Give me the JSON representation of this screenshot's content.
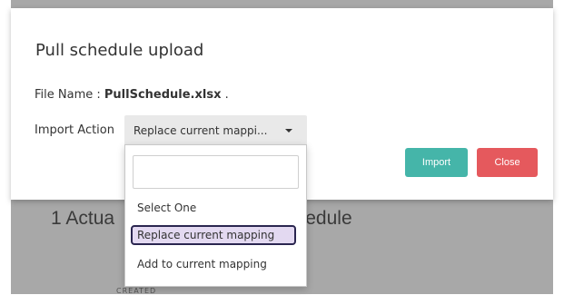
{
  "background": {
    "heading_left": "1 Actua",
    "heading_right": "chedule",
    "subtext": "CREATED"
  },
  "dialog": {
    "title": "Pull schedule upload",
    "file_label": "File Name : ",
    "file_name": "PullSchedule.xlsx",
    "file_suffix": " .",
    "import_action_label": "Import Action",
    "select_value": "Replace current mappi...",
    "import_button": "Import",
    "close_button": "Close"
  },
  "dropdown": {
    "search_value": "",
    "options": [
      {
        "label": "Select One"
      },
      {
        "label": "Replace current mapping"
      },
      {
        "label": "Add to current mapping"
      }
    ]
  },
  "colors": {
    "import": "#45b5a9",
    "close": "#e5595d",
    "highlight": "#e3d9f1"
  }
}
